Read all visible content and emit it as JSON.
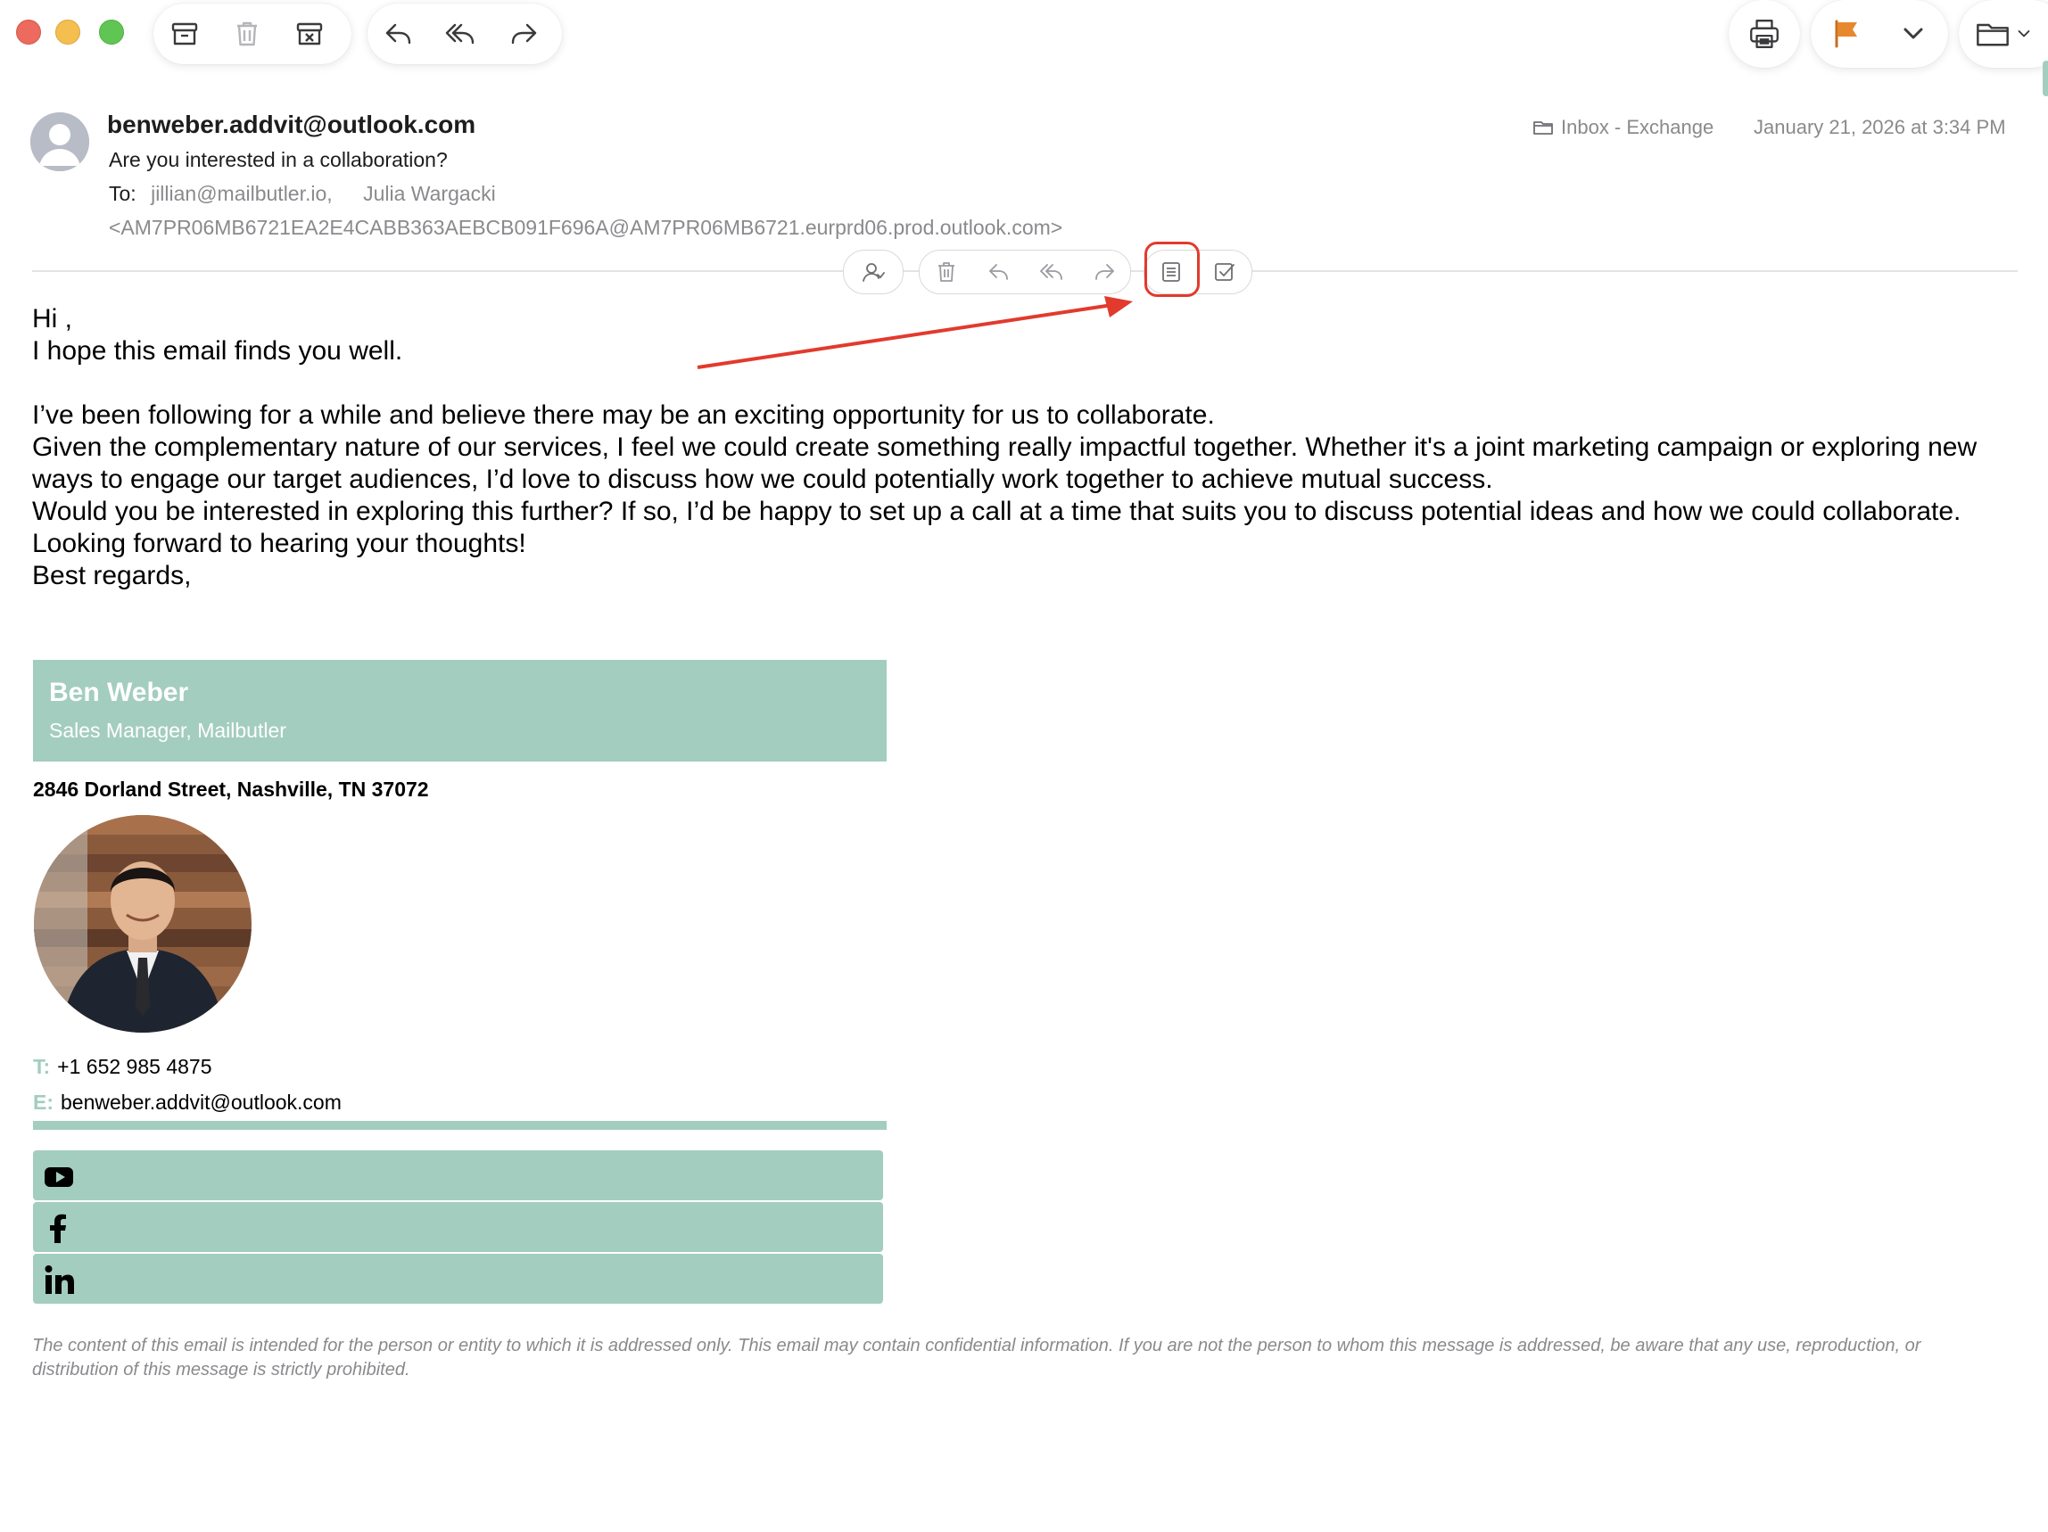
{
  "toolbar": {
    "left_icons": [
      "archive-icon",
      "trash-icon",
      "junk-icon",
      "reply-icon",
      "reply-all-icon",
      "forward-icon"
    ],
    "right_icons": [
      "print-icon",
      "flag-icon",
      "chevron-down-icon",
      "move-folder-icon"
    ],
    "flag_color": "#e8882e"
  },
  "message": {
    "sender": "benweber.addvit@outlook.com",
    "subject": "Are you interested in a collaboration?",
    "to_label": "To:",
    "recipients": [
      "jillian@mailbutler.io,",
      "Julia Wargacki"
    ],
    "message_id": "<AM7PR06MB6721EA2E4CABB363AEBCB091F696A@AM7PR06MB6721.eurprd06.prod.outlook.com>",
    "mailbox": "Inbox - Exchange",
    "date": "January 21, 2026 at 3:34 PM"
  },
  "hover_actions": [
    "contact-icon",
    "trash-icon",
    "reply-icon",
    "reply-all-icon",
    "forward-icon",
    "notes-icon",
    "task-icon"
  ],
  "body": {
    "greeting": "Hi ,",
    "line1": "I hope this email finds you well.",
    "line2": "I’ve been following for a while and believe there may be an exciting opportunity for us to collaborate.",
    "line3": "Given the complementary nature of our services, I feel we could create something really impactful together. Whether it's a joint marketing campaign or exploring new ways to engage our target audiences, I’d love to discuss how we could potentially work together to achieve mutual success.",
    "line4": "Would you be interested in exploring this further? If so, I’d be happy to set up a call at a time that suits you to discuss potential ideas and how we could collaborate.",
    "line5": "Looking forward to hearing your thoughts!",
    "closing": "Best regards,"
  },
  "signature": {
    "name": "Ben Weber",
    "role": "Sales Manager, Mailbutler",
    "address": "2846 Dorland Street, Nashville, TN 37072",
    "phone_label": "T:",
    "phone": "+1 652 985 4875",
    "email_label": "E:",
    "email": "benweber.addvit@outlook.com",
    "accent": "#a3cdbf",
    "socials": [
      "youtube-icon",
      "facebook-icon",
      "linkedin-icon"
    ]
  },
  "disclaimer": "The content of this email is intended for the person or entity to which it is addressed only. This email may contain confidential information. If you are not the person to whom this message is addressed, be aware that any use, reproduction, or distribution of this message is strictly prohibited.",
  "annotation_color": "#e23a2d"
}
